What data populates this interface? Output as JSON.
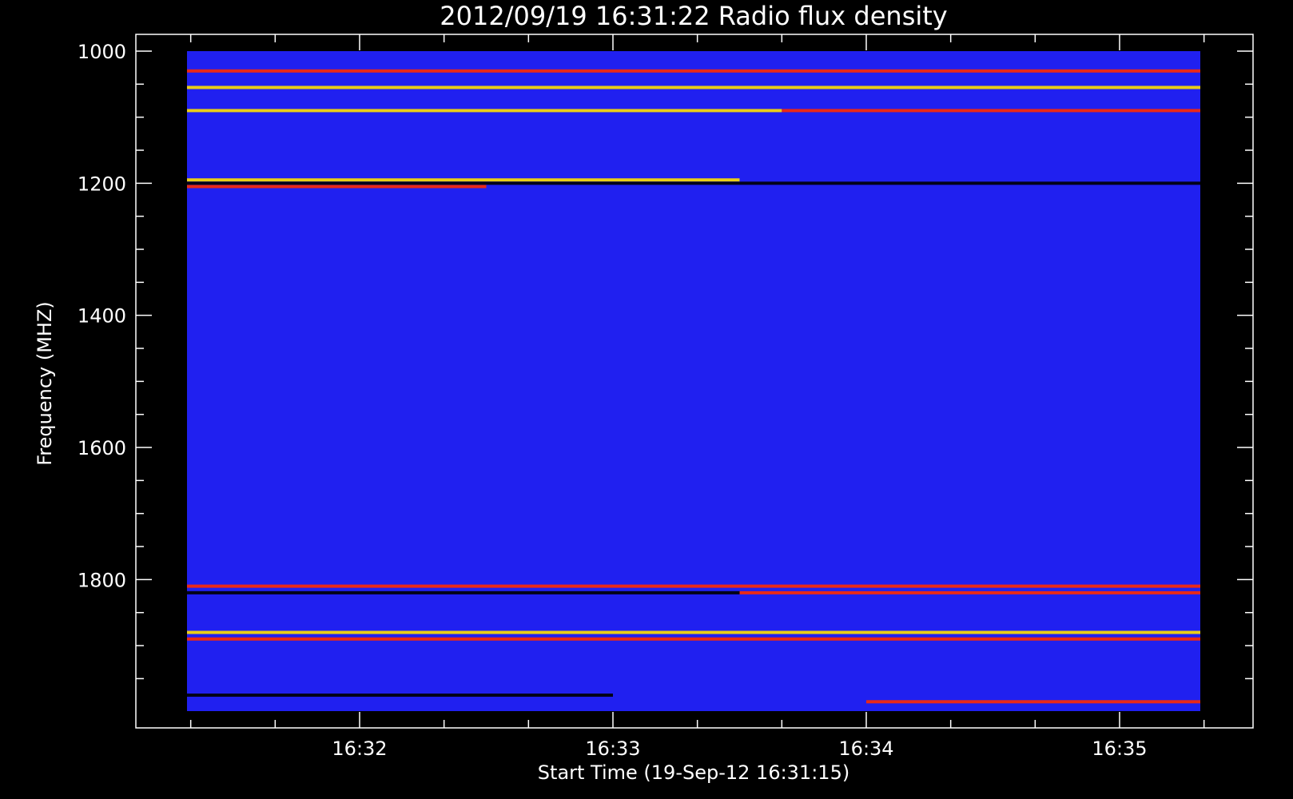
{
  "chart_data": {
    "type": "heatmap",
    "title": "2012/09/19 16:31:22 Radio flux density",
    "xlabel": "Start Time (19-Sep-12 16:31:15)",
    "ylabel": "Frequency (MHZ)",
    "x_range": [
      "16:31:15",
      "16:35:25"
    ],
    "y_range": [
      1000,
      2000
    ],
    "y_inverted": true,
    "x_ticks": [
      "16:32",
      "16:33",
      "16:34",
      "16:35"
    ],
    "y_ticks": [
      1000,
      1200,
      1400,
      1600,
      1800
    ],
    "colors": {
      "background_flux": "#2020f0",
      "low": "#000000",
      "mid": "#ff2a00",
      "high": "#ffe000"
    },
    "bands": [
      {
        "freq": 1030,
        "intensity": "mid",
        "extent": [
          "16:31:15",
          "16:35:25"
        ]
      },
      {
        "freq": 1055,
        "intensity": "high",
        "extent": [
          "16:31:15",
          "16:35:25"
        ]
      },
      {
        "freq": 1090,
        "intensity": "high",
        "extent": [
          "16:31:15",
          "16:33:40"
        ]
      },
      {
        "freq": 1090,
        "intensity": "mid",
        "extent": [
          "16:33:40",
          "16:35:25"
        ]
      },
      {
        "freq": 1195,
        "intensity": "high",
        "extent": [
          "16:31:15",
          "16:33:30"
        ]
      },
      {
        "freq": 1200,
        "intensity": "low",
        "extent": [
          "16:31:15",
          "16:35:25"
        ]
      },
      {
        "freq": 1205,
        "intensity": "mid",
        "extent": [
          "16:31:15",
          "16:32:30"
        ]
      },
      {
        "freq": 1810,
        "intensity": "mid",
        "extent": [
          "16:31:15",
          "16:35:25"
        ]
      },
      {
        "freq": 1820,
        "intensity": "low",
        "extent": [
          "16:31:15",
          "16:33:30"
        ]
      },
      {
        "freq": 1820,
        "intensity": "mid",
        "extent": [
          "16:33:30",
          "16:35:25"
        ]
      },
      {
        "freq": 1880,
        "intensity": "high",
        "extent": [
          "16:31:15",
          "16:35:25"
        ]
      },
      {
        "freq": 1890,
        "intensity": "mid",
        "extent": [
          "16:31:15",
          "16:35:25"
        ]
      },
      {
        "freq": 1975,
        "intensity": "low",
        "extent": [
          "16:31:15",
          "16:33:00"
        ]
      },
      {
        "freq": 1985,
        "intensity": "mid",
        "extent": [
          "16:34:00",
          "16:35:25"
        ]
      }
    ]
  }
}
